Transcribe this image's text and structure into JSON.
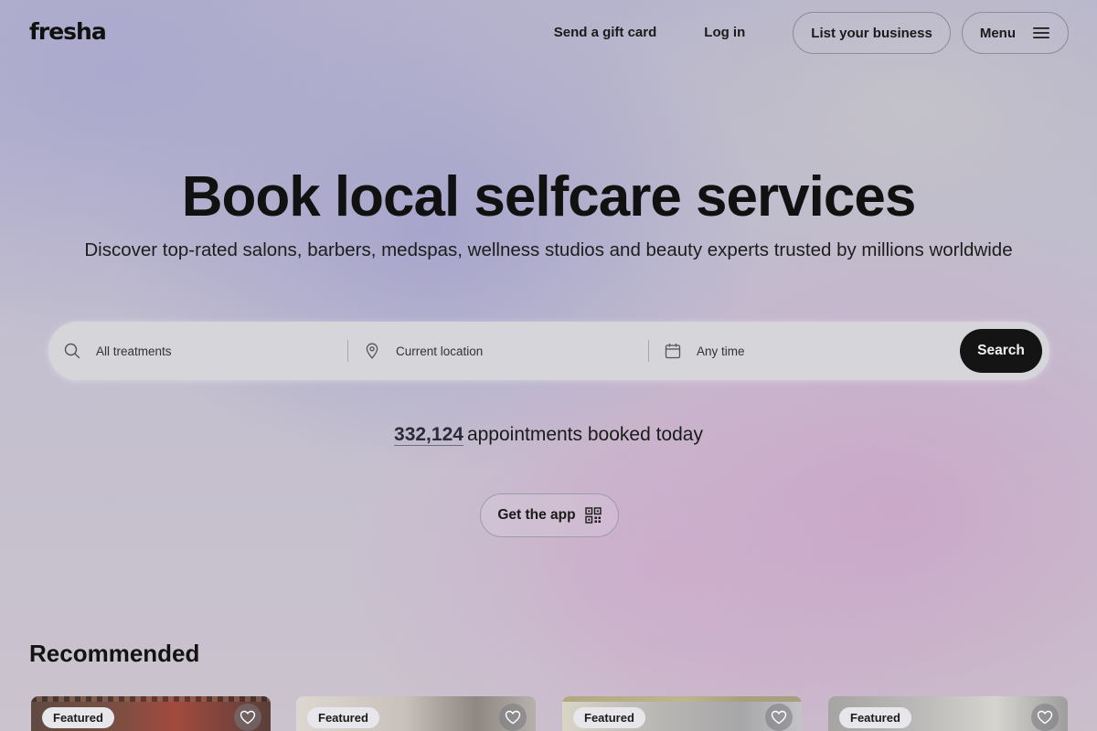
{
  "header": {
    "logo": "fresha",
    "gift_card": "Send a gift card",
    "login": "Log in",
    "list_business": "List your business",
    "menu": "Menu"
  },
  "hero": {
    "title": "Book local selfcare services",
    "subtitle": "Discover top-rated salons, barbers, medspas, wellness studios and beauty experts trusted by millions worldwide"
  },
  "search": {
    "treatments": "All treatments",
    "location": "Current location",
    "time": "Any time",
    "button": "Search"
  },
  "counter": {
    "count": "332,124",
    "label": "appointments booked today"
  },
  "app": {
    "label": "Get the app"
  },
  "recommended": {
    "title": "Recommended",
    "cards": [
      {
        "badge": "Featured"
      },
      {
        "badge": "Featured"
      },
      {
        "badge": "Featured"
      },
      {
        "badge": "Featured"
      }
    ]
  }
}
